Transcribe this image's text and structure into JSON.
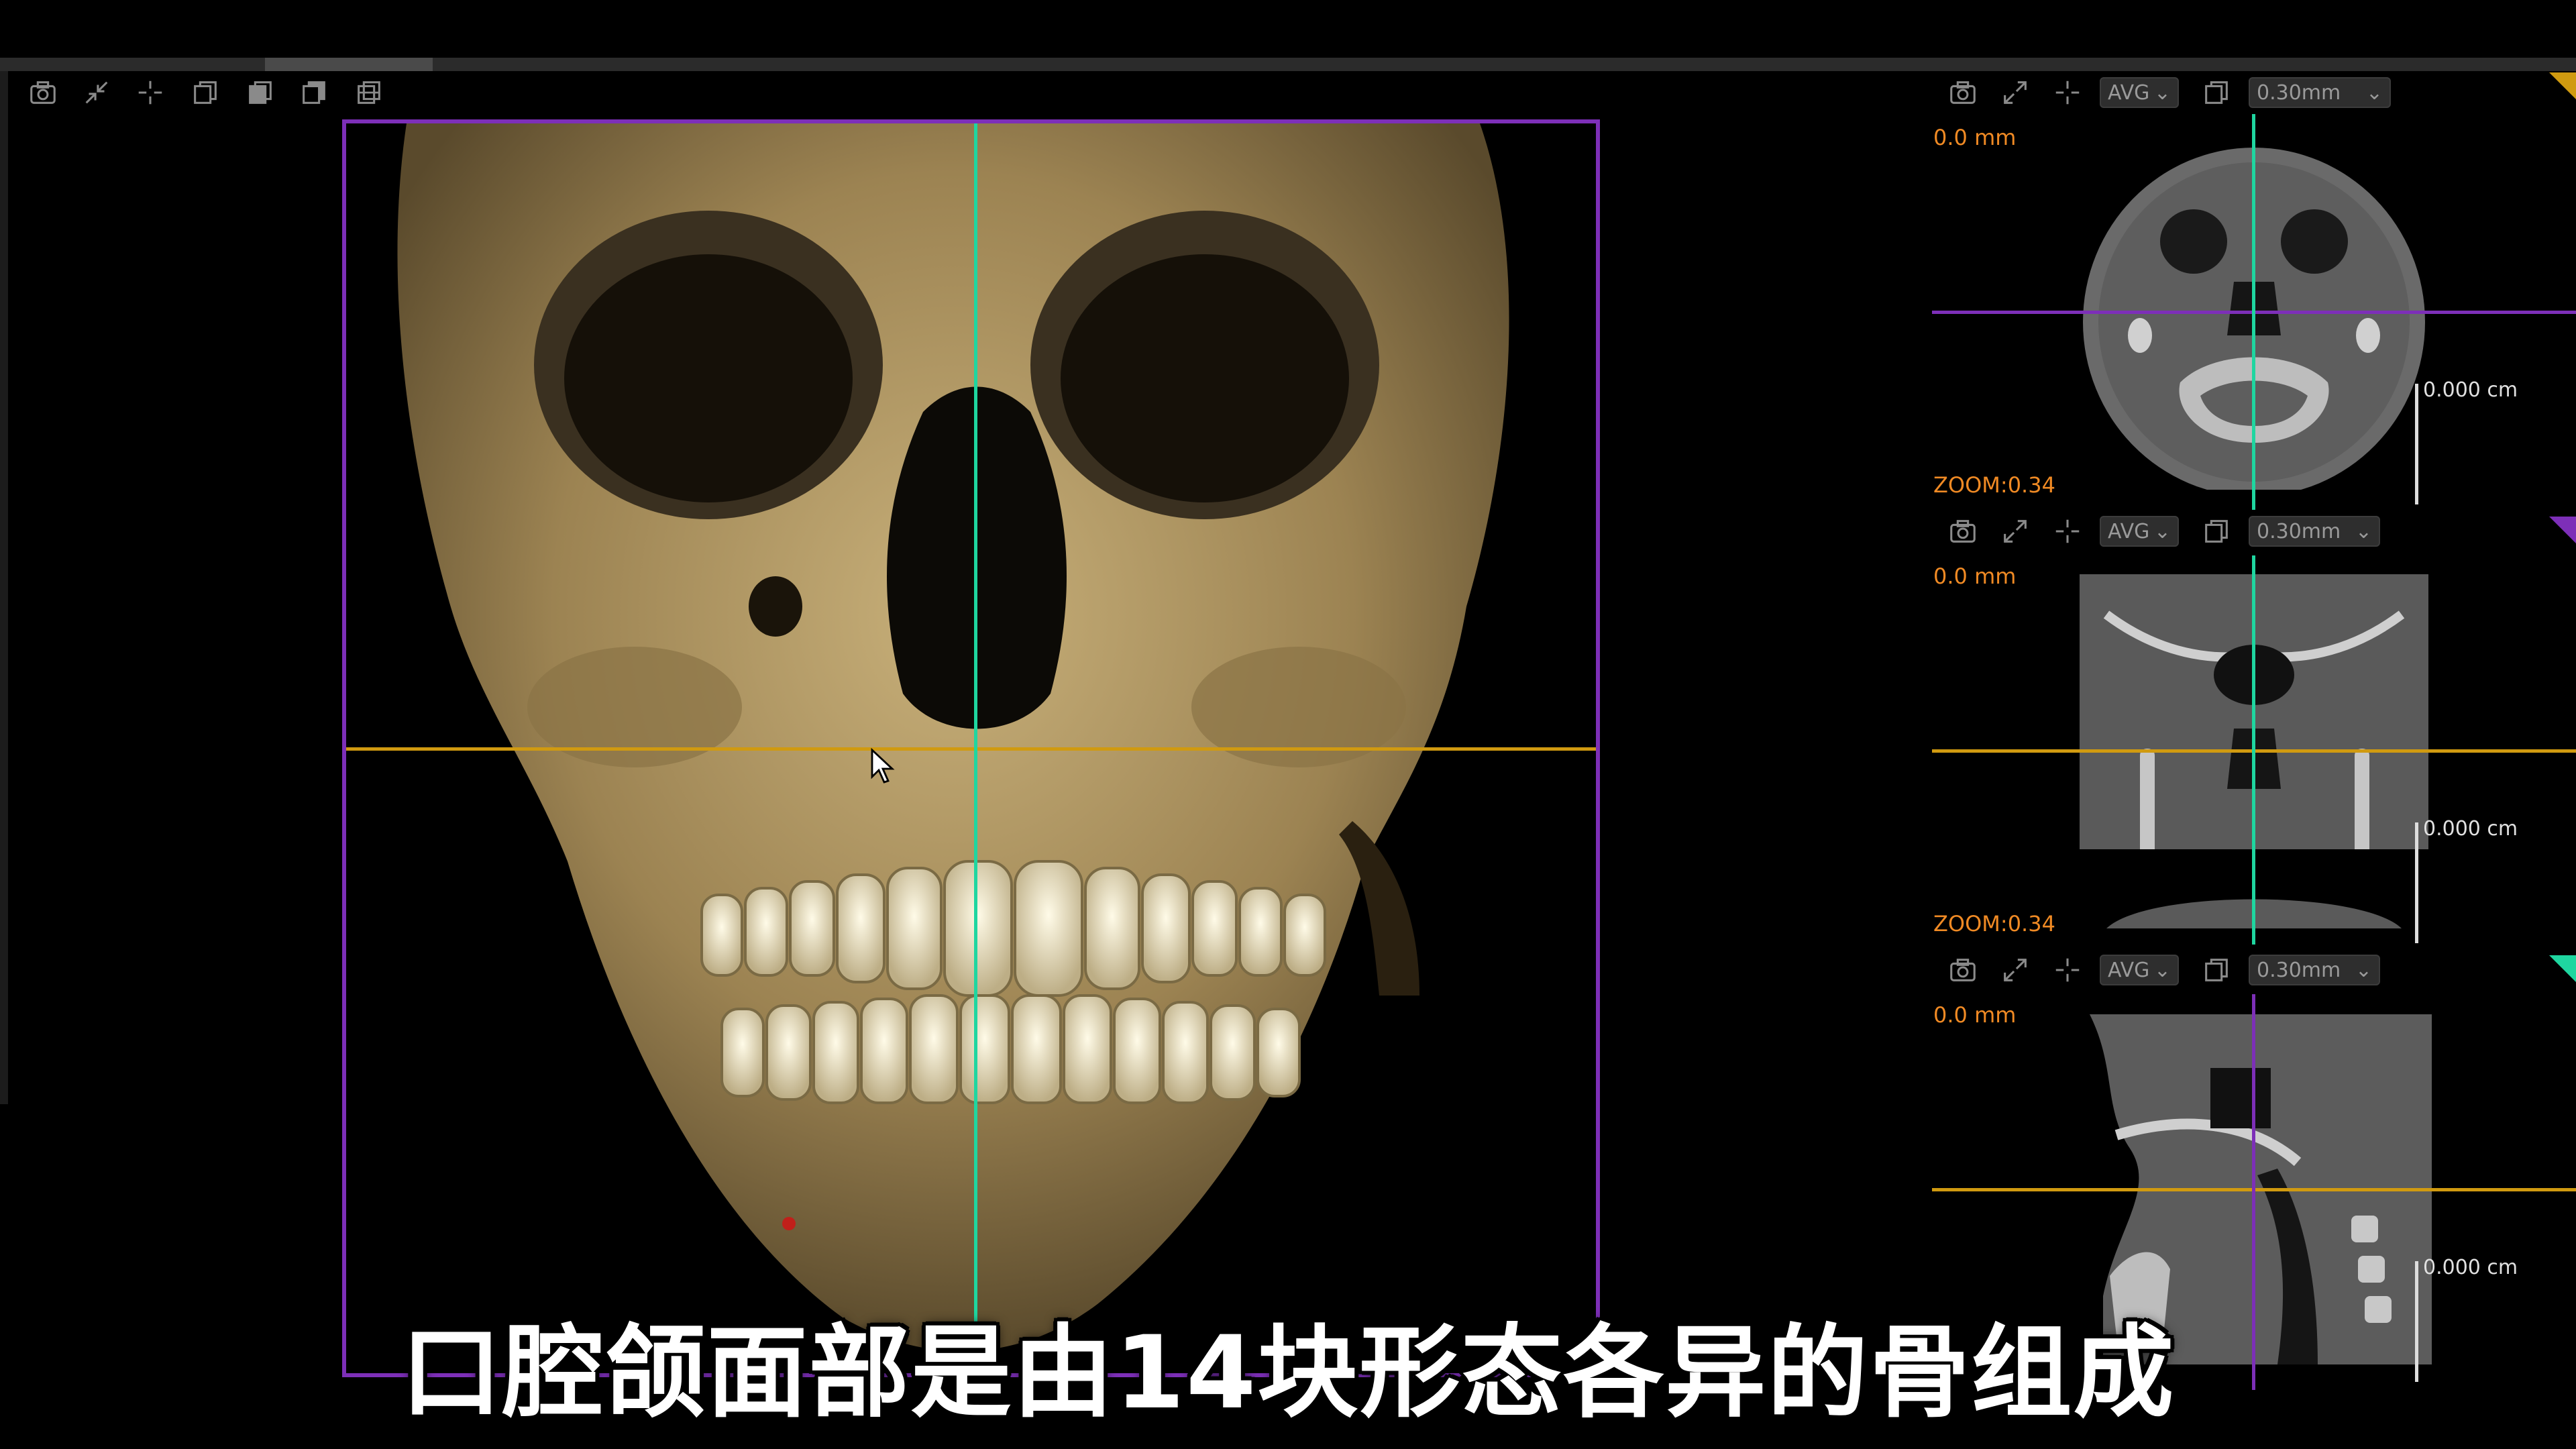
{
  "toolbar_main": {
    "icons": [
      "camera-icon",
      "collapse-icon",
      "crosshair-icon",
      "layer-front-icon",
      "layer-fill-icon",
      "layer-back-icon",
      "layer-stack-icon"
    ]
  },
  "panels": [
    {
      "depth": "0.0 mm",
      "mode": "AVG",
      "thickness": "0.30mm",
      "zoom": "ZOOM:0.34",
      "scale": "0.000 cm",
      "view": "axial"
    },
    {
      "depth": "0.0 mm",
      "mode": "AVG",
      "thickness": "0.30mm",
      "zoom": "ZOOM:0.34",
      "scale": "0.000 cm",
      "view": "coronal"
    },
    {
      "depth": "0.0 mm",
      "mode": "AVG",
      "thickness": "0.30mm",
      "zoom": "",
      "scale": "0.000 cm",
      "view": "sagittal"
    }
  ],
  "subtitle": "口腔颌面部是由14块形态各异的骨组成",
  "colors": {
    "purple": "#7d2fb8",
    "orange": "#d09a10",
    "teal": "#1fd6a0",
    "accent_orange": "#f08a24",
    "bone": "#a88f5a"
  }
}
